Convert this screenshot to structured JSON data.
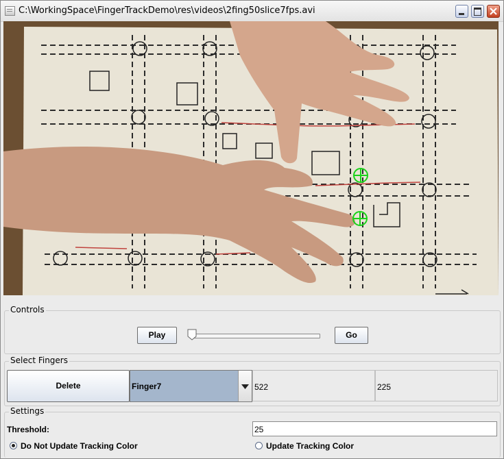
{
  "window": {
    "title": "C:\\WorkingSpace\\FingerTrackDemo\\res\\videos\\2fing50slice7fps.avi"
  },
  "icons": {
    "app": "document-icon",
    "minimize": "minimize-icon",
    "maximize": "maximize-icon",
    "close": "close-icon"
  },
  "video": {
    "markers": [
      "finger-marker-1",
      "finger-marker-2"
    ],
    "marker_color": "#19d219"
  },
  "controls": {
    "title": "Controls",
    "play_label": "Play",
    "go_label": "Go",
    "slider_value": 0
  },
  "select_fingers": {
    "title": "Select Fingers",
    "delete_label": "Delete",
    "selected_finger": "Finger7",
    "x_value": "522",
    "y_value": "225"
  },
  "settings": {
    "title": "Settings",
    "threshold_label": "Threshold:",
    "threshold_value": "25",
    "radio_no_update_label": "Do Not Update Tracking Color",
    "radio_update_label": "Update Tracking Color",
    "selected_radio": "no_update"
  }
}
